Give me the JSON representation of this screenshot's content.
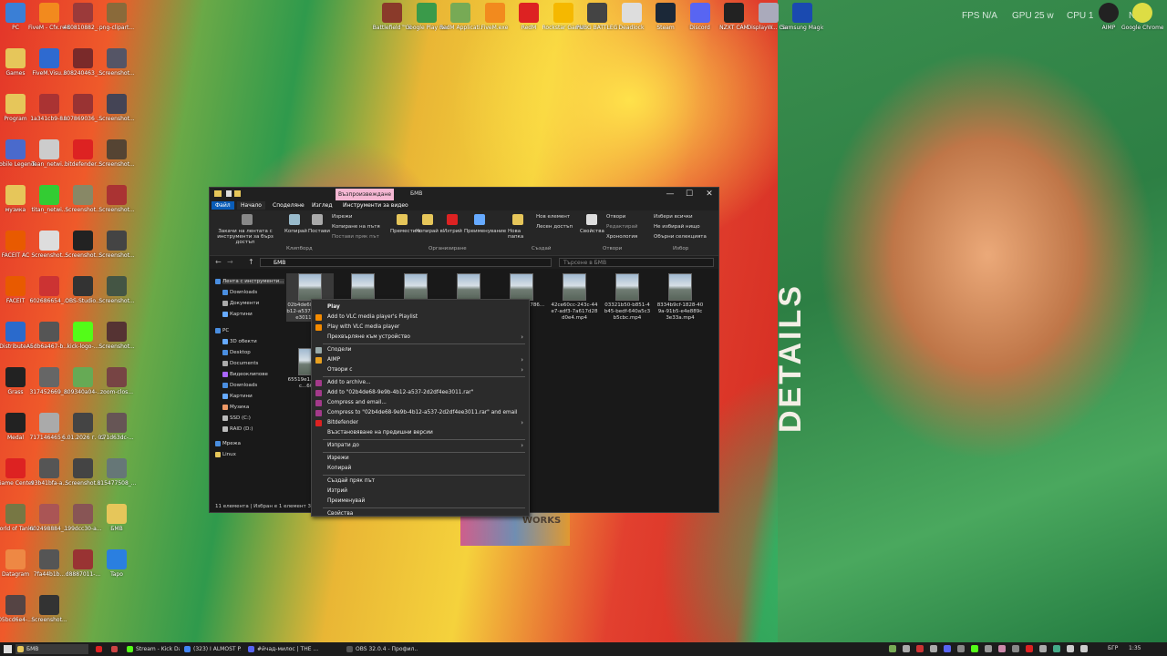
{
  "desktop": {
    "overlay_text": "DETAILS",
    "hud": {
      "fps_label": "FPS",
      "fps": "N/A",
      "gpu_label": "GPU",
      "gpu": "25 w",
      "cpu_label": "CPU",
      "cpu": "1",
      "extra": "N/A"
    },
    "left_icons": [
      {
        "label": "PC",
        "color": "#3a7fd6"
      },
      {
        "label": "FiveM - Cfx.re Devel...",
        "color": "#f28a1e"
      },
      {
        "label": "480810882_...",
        "color": "#9b3a3a"
      },
      {
        "label": "png-clipart...",
        "color": "#8a6a3a"
      },
      {
        "label": "Games",
        "color": "#e6c65a"
      },
      {
        "label": "FiveM.Visu...",
        "color": "#2e6ad0"
      },
      {
        "label": "808240463_...",
        "color": "#7a2a2a"
      },
      {
        "label": "Screenshot...",
        "color": "#556"
      },
      {
        "label": "Program",
        "color": "#e6c65a"
      },
      {
        "label": "1a341cb9-8...",
        "color": "#a33"
      },
      {
        "label": "807869036_...",
        "color": "#933"
      },
      {
        "label": "Screenshot...",
        "color": "#445"
      },
      {
        "label": "Mobile Legends:...",
        "color": "#4a6acc"
      },
      {
        "label": "Tean_netwi...",
        "color": "#ccc"
      },
      {
        "label": "bitdefender...",
        "color": "#d22"
      },
      {
        "label": "Screenshot...",
        "color": "#543"
      },
      {
        "label": "музика",
        "color": "#e6c65a"
      },
      {
        "label": "titan_netwi...",
        "color": "#3c3"
      },
      {
        "label": "Screenshot...",
        "color": "#886"
      },
      {
        "label": "Screenshot...",
        "color": "#a33"
      },
      {
        "label": "FACEIT AC",
        "color": "#e85a00"
      },
      {
        "label": "Screenshot...",
        "color": "#ddd"
      },
      {
        "label": "Screenshot...",
        "color": "#222"
      },
      {
        "label": "Screenshot...",
        "color": "#444"
      },
      {
        "label": "FACEIT",
        "color": "#e85a00"
      },
      {
        "label": "602686654_...",
        "color": "#c33"
      },
      {
        "label": "OBS-Studio...",
        "color": "#333"
      },
      {
        "label": "Screenshot...",
        "color": "#454"
      },
      {
        "label": "DistributeAI",
        "color": "#2a6acc"
      },
      {
        "label": "5db6a467-b...",
        "color": "#555"
      },
      {
        "label": "kick-logo-...",
        "color": "#53fc18"
      },
      {
        "label": "Screenshot...",
        "color": "#533"
      },
      {
        "label": "Grass",
        "color": "#222"
      },
      {
        "label": "317452669_...",
        "color": "#666"
      },
      {
        "label": "809340a04-...",
        "color": "#6a5"
      },
      {
        "label": "zoom-clos...",
        "color": "#744"
      },
      {
        "label": "Medal",
        "color": "#222"
      },
      {
        "label": "717146465_...",
        "color": "#aaa"
      },
      {
        "label": "6.01.2026 г. 02_15_14.png",
        "color": "#444"
      },
      {
        "label": "c71d63dc-...",
        "color": "#655"
      },
      {
        "label": "Game Center",
        "color": "#d22"
      },
      {
        "label": "93b41bfa-a...",
        "color": "#555"
      },
      {
        "label": "Screenshot...",
        "color": "#444"
      },
      {
        "label": "815477508_...",
        "color": "#677"
      },
      {
        "label": "World of Tanks EU",
        "color": "#774"
      },
      {
        "label": "602498884_...",
        "color": "#a55"
      },
      {
        "label": "199dcc30-a...",
        "color": "#855"
      },
      {
        "label": "БМВ",
        "color": "#e6c65a"
      },
      {
        "label": "Datagram",
        "color": "#e84"
      },
      {
        "label": "7fa44b1b...",
        "color": "#555"
      },
      {
        "label": "d8887011-...",
        "color": "#933"
      },
      {
        "label": "Tapo",
        "color": "#2a7fe0"
      },
      {
        "label": "05bcd6e4-...",
        "color": "#544"
      },
      {
        "label": "Screenshot...",
        "color": "#333"
      }
    ],
    "top_icons": [
      {
        "label": "Battlefield™ 6",
        "color": "#8a3a2a"
      },
      {
        "label": "Google Play Games",
        "color": "#3a9a4a"
      },
      {
        "label": "RedM Applicati...",
        "color": "#7a5"
      },
      {
        "label": "FiveM.exe",
        "color": "#f28a1e"
      },
      {
        "label": "RedM",
        "color": "#d22"
      },
      {
        "label": "Rockstar Games...",
        "color": "#f5b800"
      },
      {
        "label": "PUBG BATTLEGR...",
        "color": "#444"
      },
      {
        "label": "Deadlock",
        "color": "#ddd"
      },
      {
        "label": "Steam",
        "color": "#1b2838"
      },
      {
        "label": "Discord",
        "color": "#5865f2"
      },
      {
        "label": "NZXT CAM",
        "color": "#222"
      },
      {
        "label": "DisplayW... Center",
        "color": "#aab"
      },
      {
        "label": "Samsung Magician",
        "color": "#1a4ab0"
      }
    ],
    "right_icons": [
      {
        "label": "AIMP",
        "color": "#222"
      },
      {
        "label": "Google Chrome",
        "color": "#dd4"
      }
    ],
    "promo_text": "WORKS"
  },
  "explorer": {
    "title": "БМВ",
    "context_tab": "Възпроизвеждане",
    "controls": {
      "minimize": "—",
      "maximize": "☐",
      "close": "✕"
    },
    "ribbon_tabs": [
      "Файл",
      "Начало",
      "Споделяне",
      "Изглед",
      "Инструменти за видео"
    ],
    "ribbon": {
      "pin": "Закачи на лентата с инструменти за бърз достъп",
      "copy": "Копирай",
      "paste": "Постави",
      "cut": "Изрежи",
      "copy_path": "Копиране на пътя",
      "paste_shortcut": "Постави пряк път",
      "clipboard": "Клипборд",
      "move": "Премести в",
      "copy_to": "Копирай в",
      "delete": "Изтрий",
      "rename": "Преименувание",
      "organize": "Организиране",
      "new_folder": "Нова папка",
      "new_item": "Нов елемент",
      "easy_access": "Лесен достъп",
      "new_group": "Създай",
      "properties": "Свойства",
      "open": "Отвори",
      "edit": "Редактирай",
      "history": "Хронология",
      "open_group": "Отвори",
      "select_all": "Избери всички",
      "select_none": "Не избирай нищо",
      "invert": "Обърни селекцията",
      "select_group": "Избор"
    },
    "address": "БМВ",
    "search_placeholder": "Търсене в БМВ",
    "nav": [
      "Лента с инструменти...",
      "Downloads",
      "Документи",
      "Картини",
      "PC",
      "3D обекти",
      "Desktop",
      "Documents",
      "Видеоклипове",
      "Downloads",
      "Картини",
      "Музика",
      "SSD (C:)",
      "RAID (D:)",
      "Мрежа",
      "Linux"
    ],
    "files": [
      {
        "name": "02b4de68-9e9b-4b12-a537-2d2df4ee3011.mp4"
      },
      {
        "name": "...mp4"
      },
      {
        "name": "...mp4"
      },
      {
        "name": "...mp4"
      },
      {
        "name": "...1250-48ca786...mp4"
      },
      {
        "name": "42ce60cc-243c-44e7-adf3-7a617d28d0e4.mp4"
      },
      {
        "name": "03321b50-b851-4b45-bedf-640a5c3b5cbc.mp4"
      },
      {
        "name": "8334b9cf-1828-409a-91b5-e4e889c3e33a.mp4"
      },
      {
        "name": "65519e1...84e-aec...60b..."
      }
    ],
    "status": "11 елемента | Избран е 1 елемент 3..."
  },
  "context_menu": {
    "items": [
      {
        "label": "Play",
        "bold": true,
        "icon": "",
        "sub": false
      },
      {
        "label": "Add to VLC media player's Playlist",
        "icon": "vlc-icon",
        "color": "#f48b00",
        "sub": false
      },
      {
        "label": "Play with VLC media player",
        "icon": "vlc-icon",
        "color": "#f48b00",
        "sub": false
      },
      {
        "label": "Прехвърляне към устройство",
        "icon": "",
        "sub": true
      },
      {
        "label": "Сподели",
        "icon": "share-icon",
        "color": "#9aa",
        "sub": false
      },
      {
        "label": "AIMP",
        "icon": "aimp-icon",
        "color": "#e8a020",
        "sub": true
      },
      {
        "label": "Отвори с",
        "icon": "",
        "sub": true
      },
      {
        "label": "Add to archive...",
        "icon": "winrar-icon",
        "color": "#a33a8a",
        "sub": false
      },
      {
        "label": "Add to \"02b4de68-9e9b-4b12-a537-2d2df4ee3011.rar\"",
        "icon": "winrar-icon",
        "color": "#a33a8a",
        "sub": false
      },
      {
        "label": "Compress and email...",
        "icon": "winrar-icon",
        "color": "#a33a8a",
        "sub": false
      },
      {
        "label": "Compress to \"02b4de68-9e9b-4b12-a537-2d2df4ee3011.rar\" and email",
        "icon": "winrar-icon",
        "color": "#a33a8a",
        "sub": false
      },
      {
        "label": "Bitdefender",
        "icon": "bitdefender-icon",
        "color": "#d22",
        "sub": true
      },
      {
        "label": "Възстановяване на предишни версии",
        "icon": "",
        "sub": false
      },
      {
        "label": "Изпрати до",
        "icon": "",
        "sub": true
      },
      {
        "label": "Изрежи",
        "icon": "",
        "sub": false
      },
      {
        "label": "Копирай",
        "icon": "",
        "sub": false
      },
      {
        "label": "Създай пряк път",
        "icon": "",
        "sub": false
      },
      {
        "label": "Изтрий",
        "icon": "",
        "sub": false
      },
      {
        "label": "Преименувай",
        "icon": "",
        "sub": false
      },
      {
        "label": "Свойства",
        "icon": "",
        "sub": false
      }
    ],
    "arrow": "›"
  },
  "taskbar": {
    "items": [
      {
        "label": "БМВ",
        "color": "#e6c65a"
      },
      {
        "label": "",
        "color": "#d22"
      },
      {
        "label": "",
        "color": "#c44"
      },
      {
        "label": "Stream - Kick Dashbo...",
        "color": "#53fc18"
      },
      {
        "label": "(323) I ALMOST PASS...",
        "color": "#4285f4"
      },
      {
        "label": "#йчад-милос | THE ...",
        "color": "#5865f2"
      },
      {
        "label": "OBS 32.0.4 - Профил...",
        "color": "#555"
      }
    ],
    "lang": "БГР",
    "time": "1:35"
  }
}
